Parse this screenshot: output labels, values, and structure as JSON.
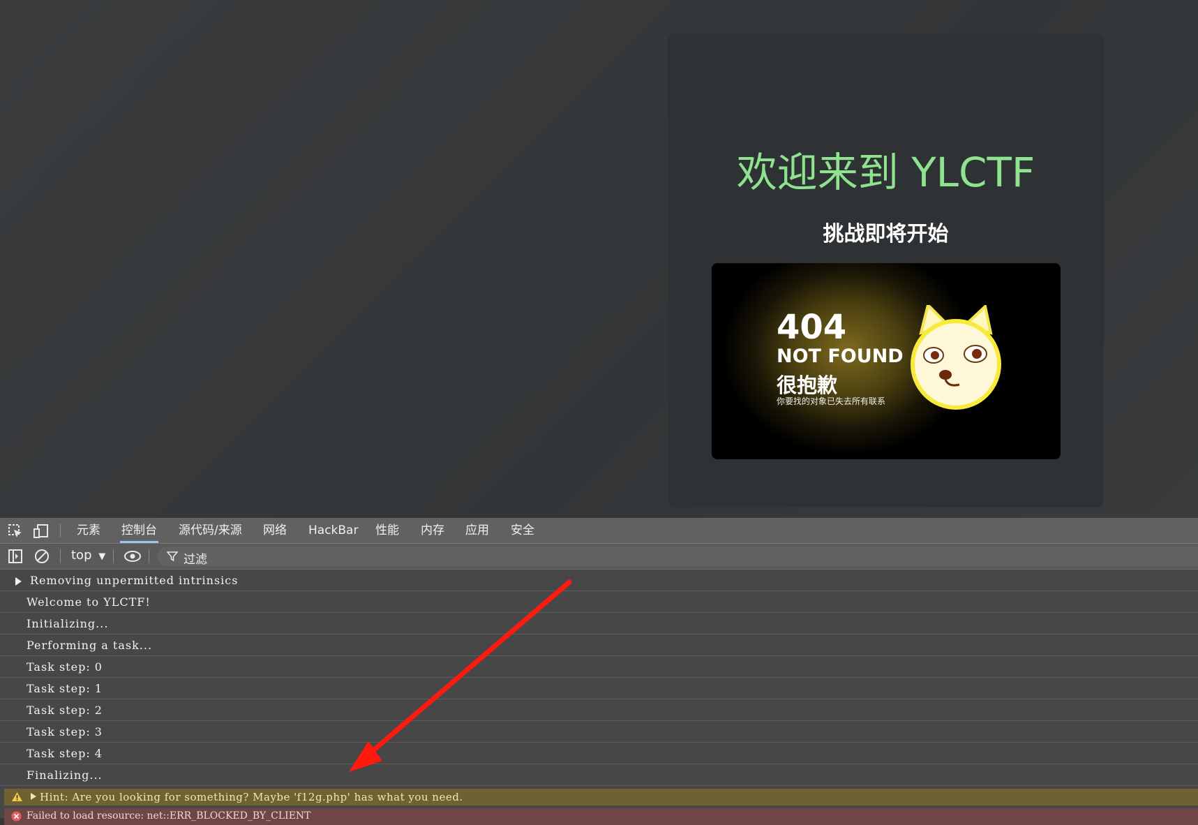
{
  "card": {
    "title": "欢迎来到 YLCTF",
    "subtitle": "挑战即将开始",
    "image": {
      "code": "404",
      "heading": "NOT FOUND",
      "sorry": "很抱歉",
      "caption": "你要找的对象已失去所有联系"
    }
  },
  "devtools": {
    "tabs": [
      "元素",
      "控制台",
      "源代码/来源",
      "网络",
      "HackBar",
      "性能",
      "内存",
      "应用",
      "安全"
    ],
    "active_tab": "控制台",
    "context": "top",
    "filter_placeholder": "过滤",
    "logs": [
      "Removing unpermitted intrinsics",
      "Welcome to YLCTF!",
      "Initializing...",
      "Performing a task...",
      "Task step: 0",
      "Task step: 1",
      "Task step: 2",
      "Task step: 3",
      "Task step: 4",
      "Finalizing..."
    ],
    "warning": "Hint: Are you looking for something? Maybe 'f12g.php' has what you need.",
    "error": "Failed to load resource: net::ERR_BLOCKED_BY_CLIENT"
  },
  "colors": {
    "title_green": "#8fe38f",
    "annotation_arrow": "#ff1a10"
  }
}
